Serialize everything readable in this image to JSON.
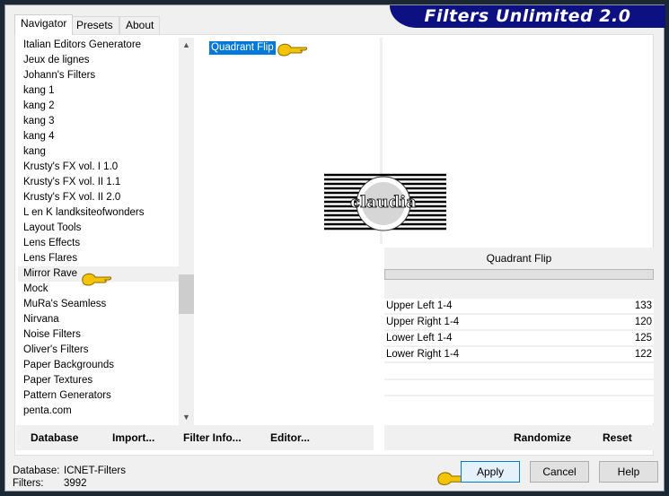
{
  "app": {
    "title": "Filters Unlimited 2.0"
  },
  "tabs": [
    {
      "label": "Navigator",
      "active": true
    },
    {
      "label": "Presets"
    },
    {
      "label": "About"
    }
  ],
  "categories": [
    "Italian Editors Generatore",
    "Jeux de lignes",
    "Johann's Filters",
    "kang 1",
    "kang 2",
    "kang 3",
    "kang 4",
    "kang",
    "Krusty's FX vol. I 1.0",
    "Krusty's FX vol. II 1.1",
    "Krusty's FX vol. II 2.0",
    "L en K landksiteofwonders",
    "Layout Tools",
    "Lens Effects",
    "Lens Flares",
    "Mirror Rave",
    "Mock",
    "MuRa's Seamless",
    "Nirvana",
    "Noise Filters",
    "Oliver's Filters",
    "Paper Backgrounds",
    "Paper Textures",
    "Pattern Generators",
    "penta.com"
  ],
  "selected_category": "Mirror Rave",
  "filters": [
    "Quadrant Flip"
  ],
  "selected_filter": "Quadrant Flip",
  "preview_logo": "claudia",
  "params": {
    "title": "Quadrant Flip",
    "rows": [
      {
        "label": "Upper Left 1-4",
        "value": "133"
      },
      {
        "label": "Upper Right 1-4",
        "value": "120"
      },
      {
        "label": "Lower Left 1-4",
        "value": "125"
      },
      {
        "label": "Lower Right 1-4",
        "value": "122"
      }
    ]
  },
  "left_buttons": {
    "database": "Database",
    "import": "Import...",
    "filter_info": "Filter Info...",
    "editor": "Editor..."
  },
  "right_buttons": {
    "randomize": "Randomize",
    "reset": "Reset"
  },
  "dialog_buttons": {
    "apply": "Apply",
    "cancel": "Cancel",
    "help": "Help"
  },
  "status": {
    "database_label": "Database:",
    "database_value": "ICNET-Filters",
    "filters_label": "Filters:",
    "filters_value": "3992"
  },
  "colors": {
    "title_bg": "#0c1080",
    "selection": "#0078d7",
    "hand": "#f5c400"
  }
}
